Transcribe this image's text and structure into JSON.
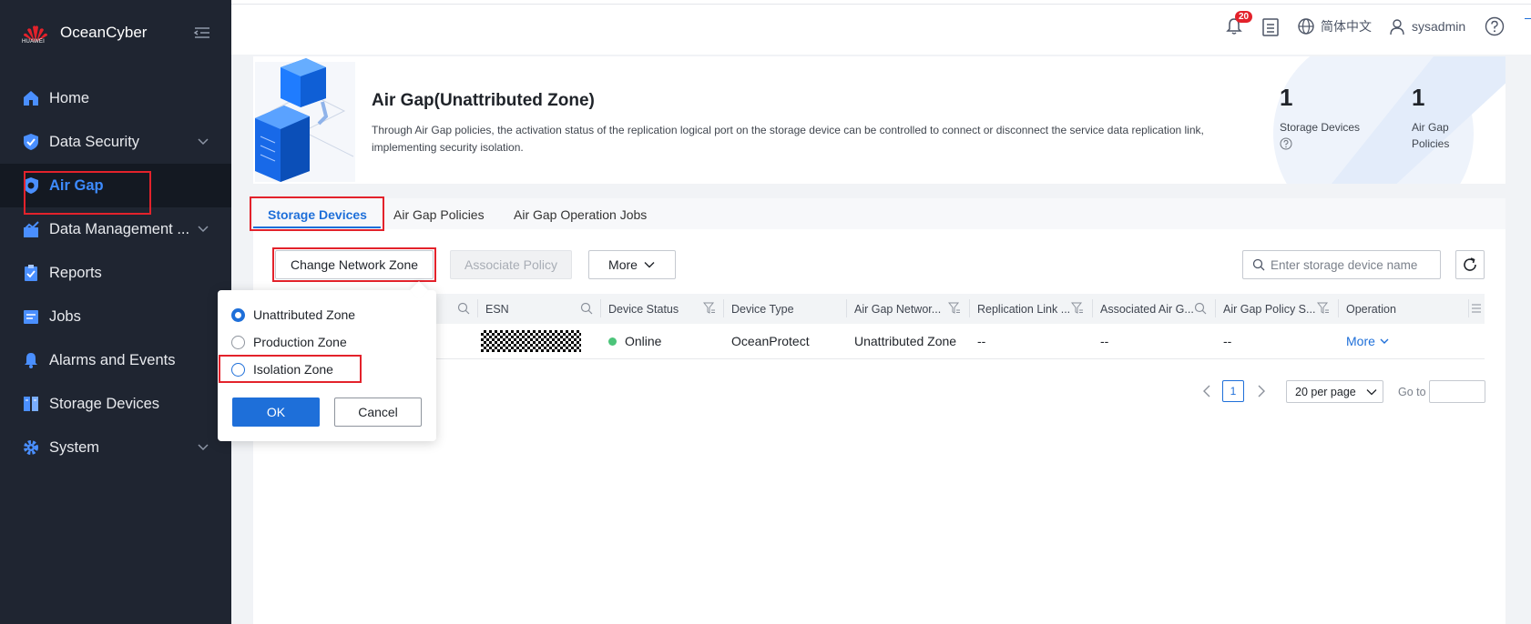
{
  "app": {
    "name": "OceanCyber",
    "logo_text": "HUAWEI"
  },
  "sidebar": {
    "items": [
      {
        "label": "Home",
        "icon": "home-icon"
      },
      {
        "label": "Data Security",
        "icon": "shield-icon",
        "expandable": true
      },
      {
        "label": "Air Gap",
        "icon": "airgap-icon",
        "active": true
      },
      {
        "label": "Data Management ...",
        "icon": "data-management-icon",
        "expandable": true
      },
      {
        "label": "Reports",
        "icon": "reports-icon"
      },
      {
        "label": "Jobs",
        "icon": "jobs-icon"
      },
      {
        "label": "Alarms and Events",
        "icon": "bell-icon"
      },
      {
        "label": "Storage Devices",
        "icon": "storage-icon"
      },
      {
        "label": "System",
        "icon": "gear-icon",
        "expandable": true
      }
    ]
  },
  "topbar": {
    "notification_count": "20",
    "language": "简体中文",
    "user": "sysadmin"
  },
  "banner": {
    "title": "Air Gap(Unattributed Zone)",
    "description": "Through Air Gap policies, the activation status of the replication logical port on the storage device can be controlled to connect or disconnect the service data replication link, implementing security isolation.",
    "stats": [
      {
        "value": "1",
        "label": "Storage Devices"
      },
      {
        "value": "1",
        "label_line1": "Air Gap",
        "label_line2": "Policies"
      }
    ]
  },
  "tabs": [
    {
      "label": "Storage Devices",
      "active": true
    },
    {
      "label": "Air Gap Policies"
    },
    {
      "label": "Air Gap Operation Jobs"
    }
  ],
  "toolbar": {
    "change_zone": "Change Network Zone",
    "associate_policy": "Associate Policy",
    "more": "More"
  },
  "search": {
    "placeholder": "Enter storage device name",
    "value": ""
  },
  "table": {
    "columns": [
      "ESN",
      "Device Status",
      "Device Type",
      "Air Gap Networ...",
      "Replication Link ...",
      "Associated Air G...",
      "Air Gap Policy S...",
      "Operation"
    ],
    "rows": [
      {
        "esn": "",
        "status": "Online",
        "type": "OceanProtect",
        "zone": "Unattributed Zone",
        "replication": "--",
        "associated": "--",
        "policy_status": "--",
        "operation": "More"
      }
    ]
  },
  "pagination": {
    "current": "1",
    "per_page": "20 per page",
    "goto_label": "Go to"
  },
  "popover": {
    "options": [
      {
        "label": "Unattributed Zone",
        "checked": true
      },
      {
        "label": "Production Zone",
        "checked": false
      },
      {
        "label": "Isolation Zone",
        "checked": false
      }
    ],
    "ok": "OK",
    "cancel": "Cancel"
  },
  "colors": {
    "sidebar_bg": "#1f2531",
    "accent": "#1e6fd9",
    "highlight_box": "#e3222b",
    "online": "#4cc47a"
  }
}
